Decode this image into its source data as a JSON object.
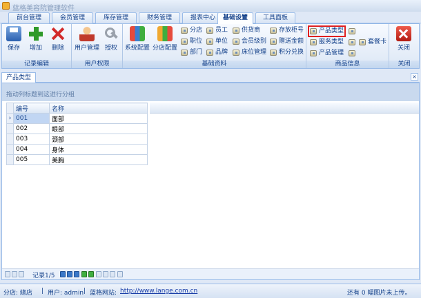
{
  "app": {
    "title": "蓝格美容院管理软件"
  },
  "tabs": [
    "前台管理",
    "会员管理",
    "库存管理",
    "财务管理",
    "报表中心",
    "基础设置",
    "工具面板"
  ],
  "active_tab": "基础设置",
  "ribbon": {
    "groups": [
      {
        "label": "记录编辑",
        "buttons": [
          "保存",
          "增加",
          "删除"
        ]
      },
      {
        "label": "用户权限",
        "buttons": [
          "用户管理",
          "授权"
        ]
      },
      {
        "label": "基础资料",
        "big_buttons": [
          "系统配置",
          "分店配置"
        ],
        "small_buttons": [
          "分店",
          "员工",
          "供货商",
          "存放柜号",
          "职位",
          "单位",
          "会员级别",
          "赠送金额",
          "部门",
          "品牌",
          "床位管理",
          "积分兑换"
        ]
      },
      {
        "label": "商品信息",
        "small_buttons": [
          "产品类型",
          "服务类型",
          "套餐卡",
          "产品管理"
        ]
      },
      {
        "label": "关闭",
        "buttons": [
          "关闭"
        ]
      }
    ],
    "highlighted": "产品类型"
  },
  "doc_tab": {
    "label": "产品类型",
    "close": "×"
  },
  "grid": {
    "group_hint": "拖动列标题到这进行分组",
    "columns": [
      "编号",
      "名称"
    ],
    "rows": [
      [
        "001",
        "面部"
      ],
      [
        "002",
        "眼部"
      ],
      [
        "003",
        "颈部"
      ],
      [
        "004",
        "身体"
      ],
      [
        "005",
        "美胸"
      ]
    ],
    "selected_row": 0,
    "row_indicator": "›"
  },
  "navigator": {
    "record_text": "记录1/5"
  },
  "status": {
    "branch": "分店: 總店",
    "user": "用户: admin",
    "site_label": "蓝格网站:",
    "site_url": "http://www.lange.com.cn",
    "right_text": "还有 0 幅图片未上传。"
  },
  "colors": {
    "highlight": "#e02020",
    "accent": "#15428b",
    "frame": "#99bbe8"
  }
}
